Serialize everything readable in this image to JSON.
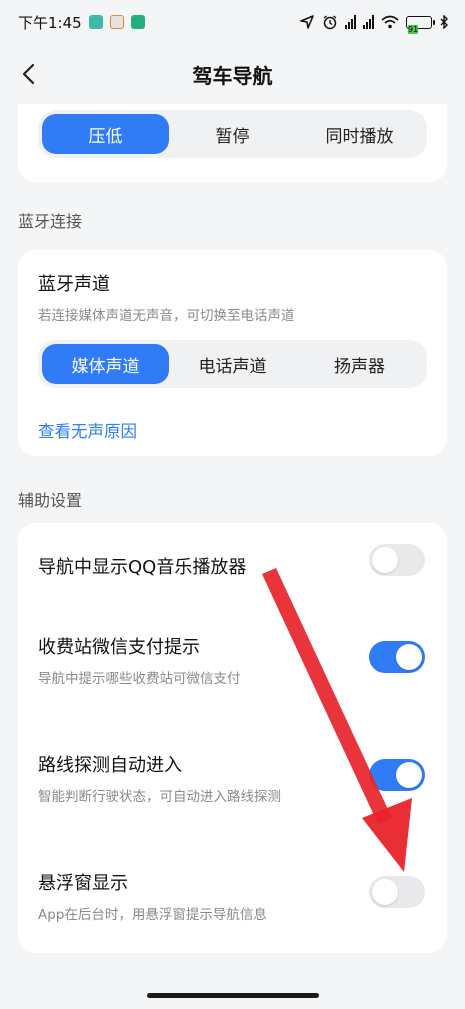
{
  "status_bar": {
    "time": "下午1:45",
    "battery": "91"
  },
  "header": {
    "title": "驾车导航"
  },
  "audio_mode": {
    "options": [
      "压低",
      "暂停",
      "同时播放"
    ],
    "selected": "压低"
  },
  "bluetooth": {
    "section_label": "蓝牙连接",
    "title": "蓝牙声道",
    "subtitle": "若连接媒体声道无声音，可切换至电话声道",
    "options": [
      "媒体声道",
      "电话声道",
      "扬声器"
    ],
    "selected": "媒体声道",
    "link": "查看无声原因"
  },
  "assist": {
    "section_label": "辅助设置",
    "items": [
      {
        "title": "导航中显示QQ音乐播放器",
        "subtitle": "",
        "on": false
      },
      {
        "title": "收费站微信支付提示",
        "subtitle": "导航中提示哪些收费站可微信支付",
        "on": true
      },
      {
        "title": "路线探测自动进入",
        "subtitle": "智能判断行驶状态，可自动进入路线探测",
        "on": true
      },
      {
        "title": "悬浮窗显示",
        "subtitle": "App在后台时，用悬浮窗提示导航信息",
        "on": false
      }
    ]
  },
  "colors": {
    "accent": "#2f7cf6",
    "annotation_arrow": "#e8232a"
  }
}
